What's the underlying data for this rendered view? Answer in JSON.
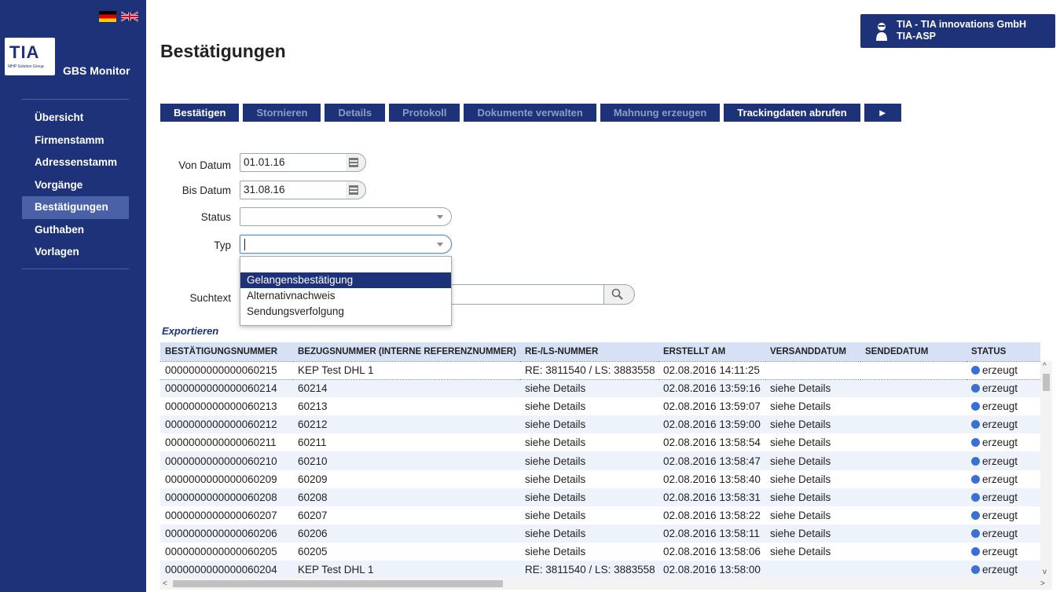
{
  "sidebar": {
    "app_name": "GBS Monitor",
    "logo": "TIA",
    "logo_sub": "MHP Solution Group",
    "items": [
      {
        "label": "Übersicht",
        "active": false
      },
      {
        "label": "Firmenstamm",
        "active": false
      },
      {
        "label": "Adressenstamm",
        "active": false
      },
      {
        "label": "Vorgänge",
        "active": false
      },
      {
        "label": "Bestätigungen",
        "active": true
      },
      {
        "label": "Guthaben",
        "active": false
      },
      {
        "label": "Vorlagen",
        "active": false
      }
    ]
  },
  "header": {
    "title": "Bestätigungen",
    "user": {
      "name": "TIA - TIA innovations GmbH",
      "role": "TIA-ASP"
    }
  },
  "toolbar": {
    "buttons": [
      {
        "label": "Bestätigen",
        "enabled": true
      },
      {
        "label": "Stornieren",
        "enabled": false
      },
      {
        "label": "Details",
        "enabled": false
      },
      {
        "label": "Protokoll",
        "enabled": false
      },
      {
        "label": "Dokumente verwalten",
        "enabled": false
      },
      {
        "label": "Mahnung erzeugen",
        "enabled": false
      },
      {
        "label": "Trackingdaten abrufen",
        "enabled": true
      },
      {
        "label": "►",
        "enabled": true
      }
    ]
  },
  "filters": {
    "von_datum": {
      "label": "Von Datum",
      "value": "01.01.16"
    },
    "bis_datum": {
      "label": "Bis Datum",
      "value": "31.08.16"
    },
    "status": {
      "label": "Status",
      "value": ""
    },
    "typ": {
      "label": "Typ",
      "value": "",
      "options": [
        "",
        "Gelangensbestätigung",
        "Alternativnachweis",
        "Sendungsverfolgung"
      ],
      "highlighted": "Gelangensbestätigung"
    },
    "suchtext": {
      "label": "Suchtext",
      "value": ""
    }
  },
  "export_label": "Exportieren",
  "table": {
    "columns": [
      "BESTÄTIGUNGSNUMMER",
      "BEZUGSNUMMER (INTERNE REFERENZNUMMER)",
      "RE-/LS-NUMMER",
      "ERSTELLT AM",
      "VERSANDDATUM",
      "SENDEDATUM",
      "STATUS"
    ],
    "rows": [
      [
        "0000000000000060215",
        "KEP Test DHL 1",
        "RE: 3811540 / LS: 3883558",
        "02.08.2016 14:11:25",
        "",
        "",
        "erzeugt"
      ],
      [
        "0000000000000060214",
        "60214",
        "siehe Details",
        "02.08.2016 13:59:16",
        "siehe Details",
        "",
        "erzeugt"
      ],
      [
        "0000000000000060213",
        "60213",
        "siehe Details",
        "02.08.2016 13:59:07",
        "siehe Details",
        "",
        "erzeugt"
      ],
      [
        "0000000000000060212",
        "60212",
        "siehe Details",
        "02.08.2016 13:59:00",
        "siehe Details",
        "",
        "erzeugt"
      ],
      [
        "0000000000000060211",
        "60211",
        "siehe Details",
        "02.08.2016 13:58:54",
        "siehe Details",
        "",
        "erzeugt"
      ],
      [
        "0000000000000060210",
        "60210",
        "siehe Details",
        "02.08.2016 13:58:47",
        "siehe Details",
        "",
        "erzeugt"
      ],
      [
        "0000000000000060209",
        "60209",
        "siehe Details",
        "02.08.2016 13:58:40",
        "siehe Details",
        "",
        "erzeugt"
      ],
      [
        "0000000000000060208",
        "60208",
        "siehe Details",
        "02.08.2016 13:58:31",
        "siehe Details",
        "",
        "erzeugt"
      ],
      [
        "0000000000000060207",
        "60207",
        "siehe Details",
        "02.08.2016 13:58:22",
        "siehe Details",
        "",
        "erzeugt"
      ],
      [
        "0000000000000060206",
        "60206",
        "siehe Details",
        "02.08.2016 13:58:11",
        "siehe Details",
        "",
        "erzeugt"
      ],
      [
        "0000000000000060205",
        "60205",
        "siehe Details",
        "02.08.2016 13:58:06",
        "siehe Details",
        "",
        "erzeugt"
      ],
      [
        "0000000000000060204",
        "KEP Test DHL 1",
        "RE: 3811540 / LS: 3883558",
        "02.08.2016 13:58:00",
        "",
        "",
        "erzeugt"
      ]
    ]
  },
  "colors": {
    "brand": "#1d3278",
    "active_nav": "#4a61a8",
    "header_row": "#d6e1f5",
    "status_dot": "#3a6fd6"
  }
}
